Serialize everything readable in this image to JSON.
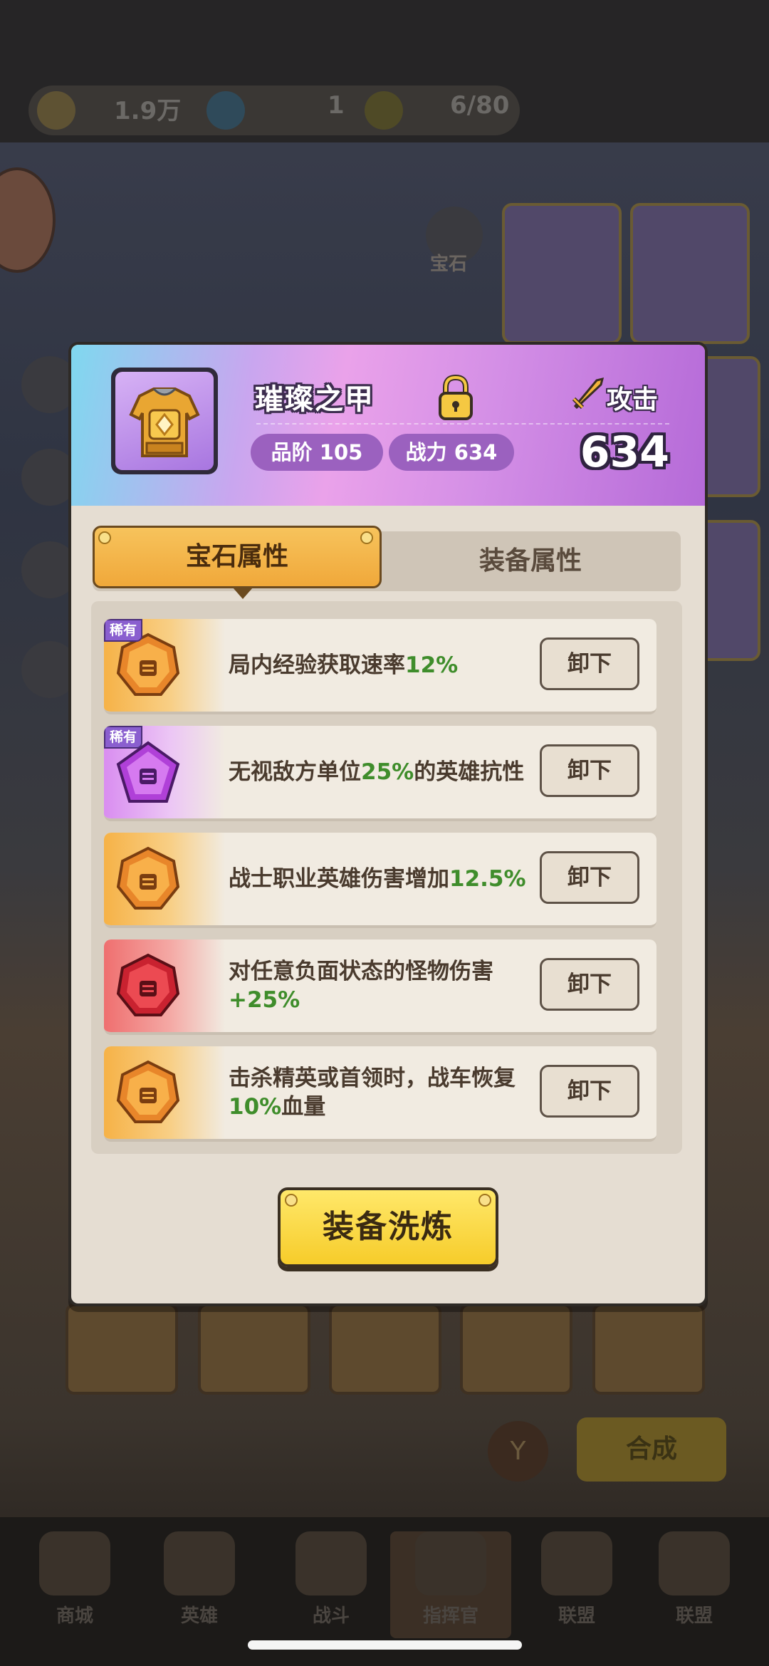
{
  "background": {
    "resources": [
      {
        "icon": "coin-icon",
        "value": "1.9万"
      },
      {
        "icon": "diamond-icon",
        "value": "1"
      },
      {
        "icon": "energy-icon",
        "value": "6/80"
      }
    ],
    "side_button": "宝石",
    "merge_button": "合成",
    "bottom_nav": [
      "商城",
      "英雄",
      "战斗",
      "指挥官",
      "联盟",
      "联盟"
    ]
  },
  "modal": {
    "item_name": "璀璨之甲",
    "item_icon": "golden-armor-icon",
    "grade_label": "品阶 105",
    "power_label": "战力 634",
    "attack_label": "攻击",
    "attack_value": "634",
    "tabs": [
      "宝石属性",
      "装备属性"
    ],
    "active_tab": 0,
    "gems": [
      {
        "rarity": "稀有",
        "color": "orange",
        "text_before": "局内经验获取速率",
        "highlight": "12%",
        "text_after": "",
        "button": "卸下"
      },
      {
        "rarity": "稀有",
        "color": "purple",
        "text_before": "无视敌方单位",
        "highlight": "25%",
        "text_after": "的英雄抗性",
        "button": "卸下"
      },
      {
        "rarity": "",
        "color": "orange",
        "text_before": "战士职业英雄伤害增加",
        "highlight": "12.5%",
        "text_after": "",
        "button": "卸下"
      },
      {
        "rarity": "",
        "color": "red",
        "text_before": "对任意负面状态的怪物伤害",
        "highlight": "+25%",
        "text_after": "",
        "button": "卸下"
      },
      {
        "rarity": "",
        "color": "orange",
        "text_before": "击杀精英或首领时，战车恢复",
        "highlight": "10%",
        "text_after": "血量",
        "button": "卸下"
      }
    ],
    "refine_button": "装备洗炼"
  },
  "colors": {
    "highlight_green": "#3f8d2b",
    "tab_active": "#f0a83a",
    "header_purple": "#d48fe6",
    "refine_yellow": "#f6cc2a"
  }
}
